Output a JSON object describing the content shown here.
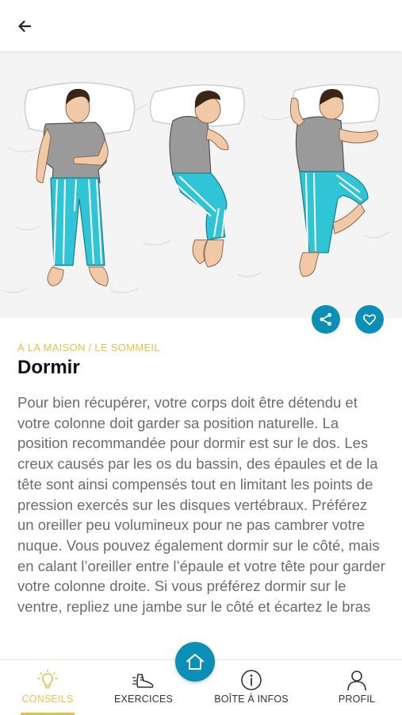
{
  "header": {
    "back_icon": "arrow-left-icon"
  },
  "hero": {
    "illustration": "three sleeping positions: on back, on side, on stomach"
  },
  "actions": {
    "share_icon": "share-icon",
    "favorite_icon": "heart-icon",
    "accent_color": "#0b8fb7"
  },
  "article": {
    "category": "À LA MAISON / LE SOMMEIL",
    "title": "Dormir",
    "body": "Pour bien récupérer, votre corps doit être détendu et votre colonne doit garder sa position naturelle. La position recommandée pour dormir est sur le dos. Les creux causés par les os du bassin, des épaules et de la tête sont ainsi compensés tout en limitant les points de pression exercés sur les disques vertébraux. Préférez un oreiller peu volumineux pour ne pas cambrer votre nuque. Vous pouvez également dormir sur le côté, mais en calant l’oreiller entre l’épaule et votre tête pour garder votre colonne droite. Si vous préférez dormir sur le ventre, repliez une jambe sur le côté et écartez le bras"
  },
  "bottom_nav": {
    "items": [
      {
        "label": "CONSEILS",
        "icon": "lightbulb-icon",
        "active": true
      },
      {
        "label": "EXERCICES",
        "icon": "running-shoe-icon",
        "active": false
      },
      {
        "label": "BOÎTE À INFOS",
        "icon": "info-icon",
        "active": false
      },
      {
        "label": "PROFIL",
        "icon": "user-icon",
        "active": false
      }
    ],
    "home_icon": "home-icon",
    "active_color": "#e3c24d"
  }
}
